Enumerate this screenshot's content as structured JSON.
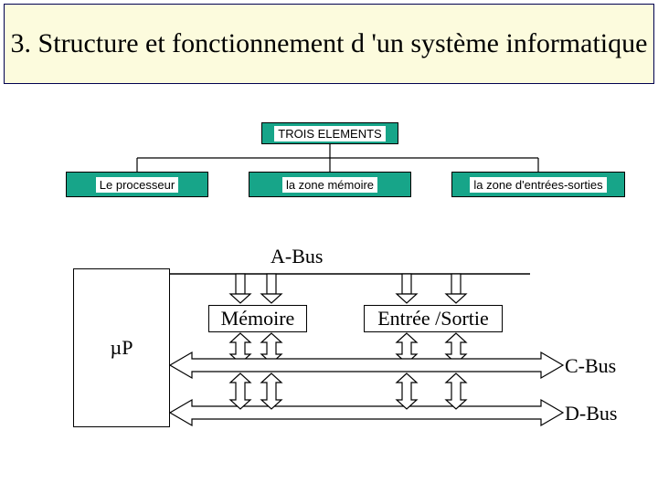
{
  "title": "3. Structure et fonctionnement d 'un système informatique",
  "org": {
    "root": "TROIS ELEMENTS",
    "children": [
      "Le processeur",
      "la zone mémoire",
      "la zone d'entrées-sorties"
    ]
  },
  "arch": {
    "abus": "A-Bus",
    "cbus": "C-Bus",
    "dbus": "D-Bus",
    "cpu": "µP",
    "memory": "Mémoire",
    "io": "Entrée /Sortie"
  }
}
